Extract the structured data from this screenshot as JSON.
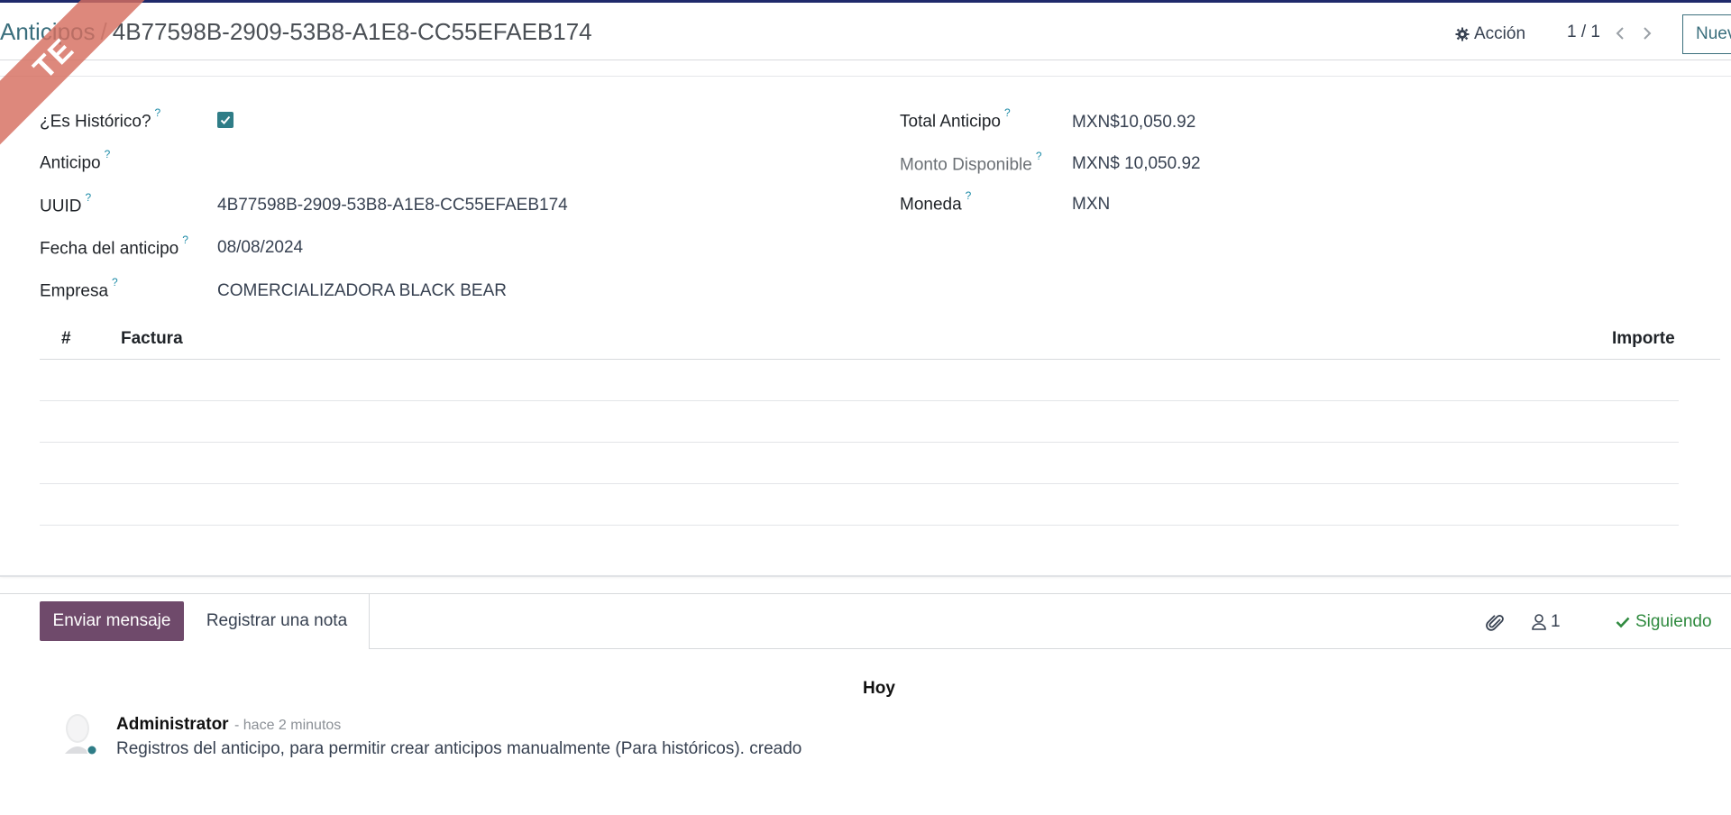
{
  "breadcrumb": {
    "parent": "Anticipos",
    "separator": "/",
    "current": "4B77598B-2909-53B8-A1E8-CC55EFAEB174"
  },
  "ribbon": {
    "text": "TE"
  },
  "toolbar": {
    "action_label": "Acción",
    "pager": "1 / 1",
    "new_label": "Nuevo"
  },
  "form": {
    "es_historico": {
      "label": "¿Es Histórico?",
      "help": "?",
      "checked": true
    },
    "anticipo": {
      "label": "Anticipo",
      "help": "?",
      "value": ""
    },
    "uuid": {
      "label": "UUID",
      "help": "?",
      "value": "4B77598B-2909-53B8-A1E8-CC55EFAEB174"
    },
    "fecha": {
      "label": "Fecha del anticipo",
      "help": "?",
      "value": "08/08/2024"
    },
    "empresa": {
      "label": "Empresa",
      "help": "?",
      "value": "COMERCIALIZADORA BLACK BEAR"
    },
    "total_anticipo": {
      "label": "Total Anticipo",
      "help": "?",
      "value": "MXN$10,050.92"
    },
    "monto_disponible": {
      "label": "Monto Disponible",
      "help": "?",
      "value": "MXN$ 10,050.92"
    },
    "moneda": {
      "label": "Moneda",
      "help": "?",
      "value": "MXN"
    }
  },
  "table": {
    "columns": [
      "#",
      "Factura",
      "Importe"
    ],
    "rows": []
  },
  "chatter": {
    "send_message": "Enviar mensaje",
    "log_note": "Registrar una nota",
    "followers_count": "1",
    "following_label": "Siguiendo",
    "date_separator": "Hoy",
    "messages": [
      {
        "author": "Administrator",
        "date": "- hace 2 minutos",
        "body": "Registros del anticipo, para permitir crear anticipos manualmente (Para históricos). creado"
      }
    ]
  },
  "colors": {
    "accent": "#3b6f7d",
    "primary_button": "#6f4a6b",
    "following": "#2f8a3f",
    "ribbon": "#d66e5f",
    "checkbox": "#2f7d87"
  }
}
